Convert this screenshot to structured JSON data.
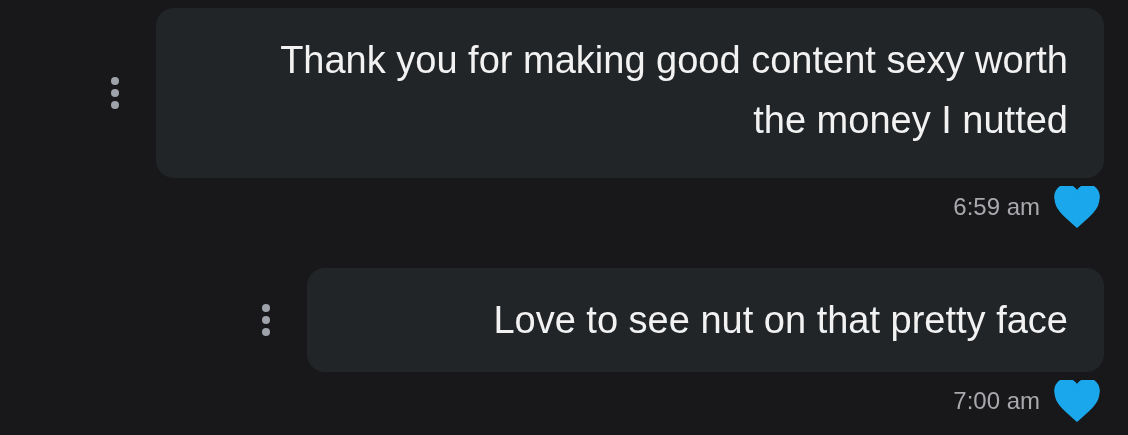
{
  "messages": [
    {
      "text": "Thank you for making good content sexy worth the money I nutted",
      "time": "6:59 am",
      "liked": true
    },
    {
      "text": "Love to see nut on that pretty face",
      "time": "7:00 am",
      "liked": true
    }
  ]
}
